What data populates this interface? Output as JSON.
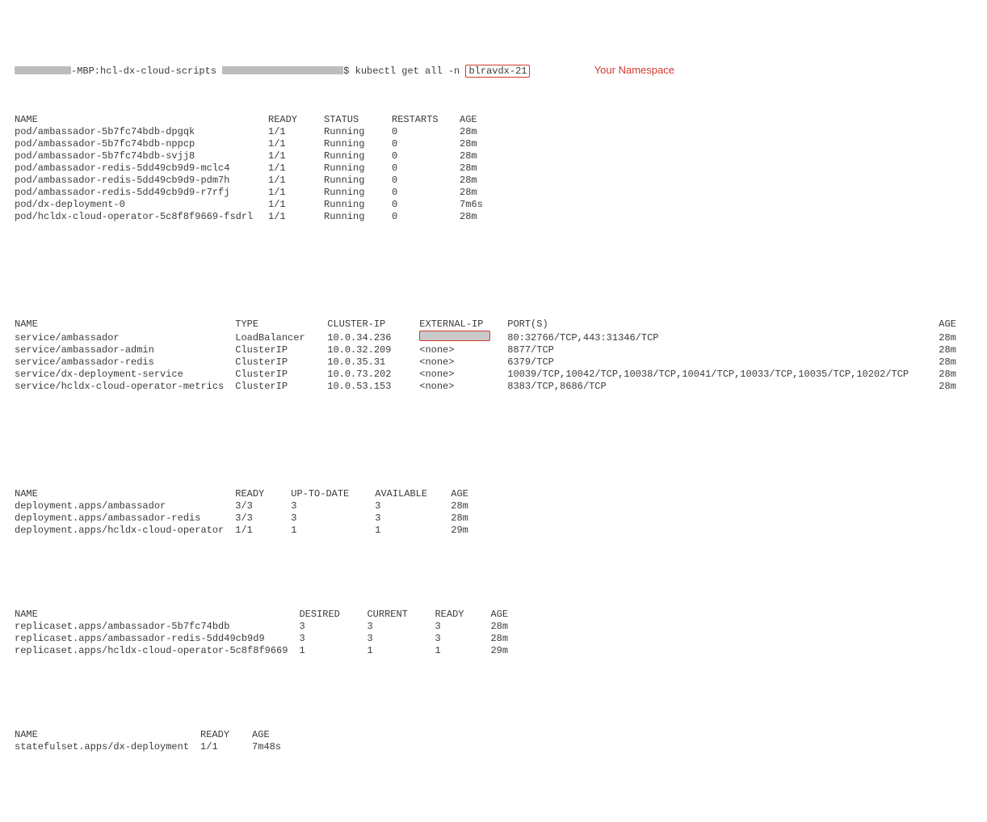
{
  "prompt": {
    "host_suffix": "-MBP:hcl-dx-cloud-scripts",
    "cmd_prefix": "$ kubectl get all -n",
    "namespace": "blravdx-21",
    "annotation": "Your Namespace"
  },
  "pods": {
    "headers": [
      "NAME",
      "READY",
      "STATUS",
      "RESTARTS",
      "AGE"
    ],
    "rows": [
      {
        "name": "pod/ambassador-5b7fc74bdb-dpgqk",
        "ready": "1/1",
        "status": "Running",
        "restarts": "0",
        "age": "28m"
      },
      {
        "name": "pod/ambassador-5b7fc74bdb-nppcp",
        "ready": "1/1",
        "status": "Running",
        "restarts": "0",
        "age": "28m"
      },
      {
        "name": "pod/ambassador-5b7fc74bdb-svjj8",
        "ready": "1/1",
        "status": "Running",
        "restarts": "0",
        "age": "28m"
      },
      {
        "name": "pod/ambassador-redis-5dd49cb9d9-mclc4",
        "ready": "1/1",
        "status": "Running",
        "restarts": "0",
        "age": "28m"
      },
      {
        "name": "pod/ambassador-redis-5dd49cb9d9-pdm7h",
        "ready": "1/1",
        "status": "Running",
        "restarts": "0",
        "age": "28m"
      },
      {
        "name": "pod/ambassador-redis-5dd49cb9d9-r7rfj",
        "ready": "1/1",
        "status": "Running",
        "restarts": "0",
        "age": "28m"
      },
      {
        "name": "pod/dx-deployment-0",
        "ready": "1/1",
        "status": "Running",
        "restarts": "0",
        "age": "7m6s"
      },
      {
        "name": "pod/hcldx-cloud-operator-5c8f8f9669-fsdrl",
        "ready": "1/1",
        "status": "Running",
        "restarts": "0",
        "age": "28m"
      }
    ]
  },
  "services": {
    "headers": [
      "NAME",
      "TYPE",
      "CLUSTER-IP",
      "EXTERNAL-IP",
      "PORT(S)",
      "AGE"
    ],
    "rows": [
      {
        "name": "service/ambassador",
        "type": "LoadBalancer",
        "cip": "10.0.34.236",
        "eip": "__REDACT__",
        "ports": "80:32766/TCP,443:31346/TCP",
        "age": "28m"
      },
      {
        "name": "service/ambassador-admin",
        "type": "ClusterIP",
        "cip": "10.0.32.209",
        "eip": "<none>",
        "ports": "8877/TCP",
        "age": "28m"
      },
      {
        "name": "service/ambassador-redis",
        "type": "ClusterIP",
        "cip": "10.0.35.31",
        "eip": "<none>",
        "ports": "6379/TCP",
        "age": "28m"
      },
      {
        "name": "service/dx-deployment-service",
        "type": "ClusterIP",
        "cip": "10.0.73.202",
        "eip": "<none>",
        "ports": "10039/TCP,10042/TCP,10038/TCP,10041/TCP,10033/TCP,10035/TCP,10202/TCP",
        "age": "28m"
      },
      {
        "name": "service/hcldx-cloud-operator-metrics",
        "type": "ClusterIP",
        "cip": "10.0.53.153",
        "eip": "<none>",
        "ports": "8383/TCP,8686/TCP",
        "age": "28m"
      }
    ]
  },
  "deployments": {
    "headers": [
      "NAME",
      "READY",
      "UP-TO-DATE",
      "AVAILABLE",
      "AGE"
    ],
    "rows": [
      {
        "name": "deployment.apps/ambassador",
        "ready": "3/3",
        "utd": "3",
        "avail": "3",
        "age": "28m"
      },
      {
        "name": "deployment.apps/ambassador-redis",
        "ready": "3/3",
        "utd": "3",
        "avail": "3",
        "age": "28m"
      },
      {
        "name": "deployment.apps/hcldx-cloud-operator",
        "ready": "1/1",
        "utd": "1",
        "avail": "1",
        "age": "29m"
      }
    ]
  },
  "replicasets": {
    "headers": [
      "NAME",
      "DESIRED",
      "CURRENT",
      "READY",
      "AGE"
    ],
    "rows": [
      {
        "name": "replicaset.apps/ambassador-5b7fc74bdb",
        "desired": "3",
        "current": "3",
        "ready": "3",
        "age": "28m"
      },
      {
        "name": "replicaset.apps/ambassador-redis-5dd49cb9d9",
        "desired": "3",
        "current": "3",
        "ready": "3",
        "age": "28m"
      },
      {
        "name": "replicaset.apps/hcldx-cloud-operator-5c8f8f9669",
        "desired": "1",
        "current": "1",
        "ready": "1",
        "age": "29m"
      }
    ]
  },
  "statefulsets": {
    "headers": [
      "NAME",
      "READY",
      "AGE"
    ],
    "rows": [
      {
        "name": "statefulset.apps/dx-deployment",
        "ready": "1/1",
        "age": "7m48s"
      }
    ]
  },
  "colwidths": {
    "pods": [
      300,
      70,
      70,
      80,
      60
    ],
    "svcs": [
      230,
      100,
      100,
      90,
      520,
      40
    ],
    "deps": [
      260,
      60,
      90,
      80,
      60
    ],
    "rs": [
      330,
      70,
      70,
      60,
      60
    ],
    "ss": [
      210,
      60,
      60
    ]
  }
}
